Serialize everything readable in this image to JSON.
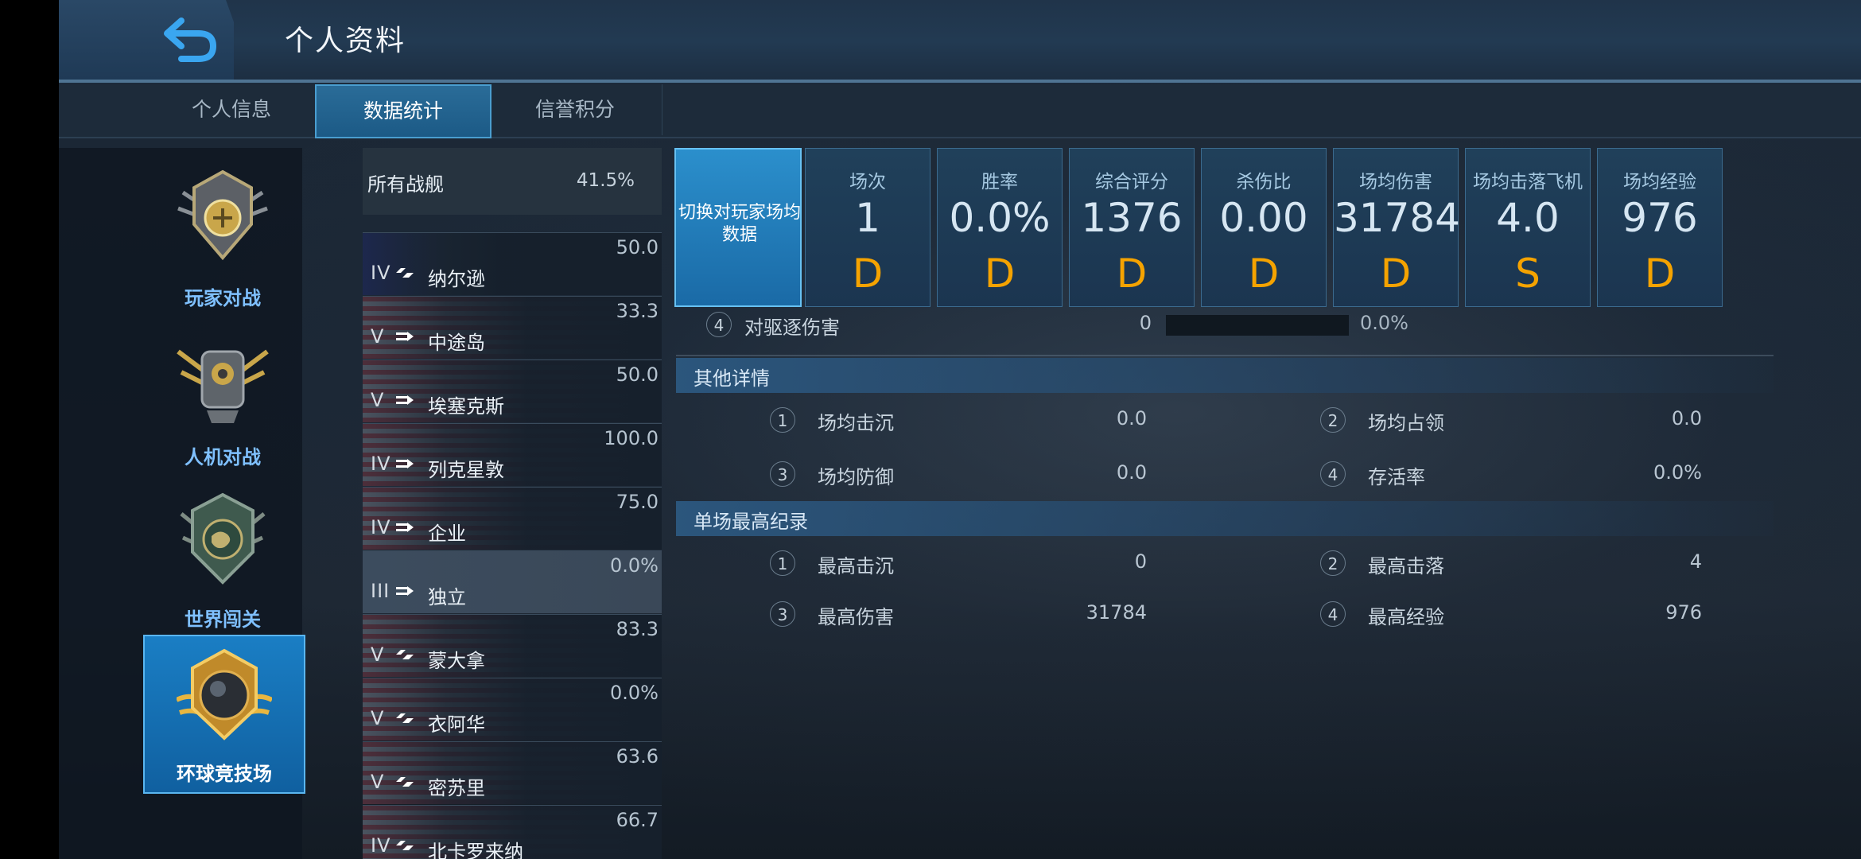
{
  "header": {
    "title": "个人资料"
  },
  "tabs": [
    {
      "label": "个人信息"
    },
    {
      "label": "数据统计"
    },
    {
      "label": "信誉积分"
    }
  ],
  "modes": [
    {
      "label": "玩家对战"
    },
    {
      "label": "人机对战"
    },
    {
      "label": "世界闯关"
    },
    {
      "label": "环球竞技场"
    }
  ],
  "ship_list": {
    "all": {
      "name": "所有战舰",
      "winrate": "41.5%"
    },
    "ships": [
      {
        "tier": "IV",
        "name": "纳尔逊",
        "winrate": "50.0"
      },
      {
        "tier": "V",
        "name": "中途岛",
        "winrate": "33.3"
      },
      {
        "tier": "V",
        "name": "埃塞克斯",
        "winrate": "50.0"
      },
      {
        "tier": "IV",
        "name": "列克星敦",
        "winrate": "100.0"
      },
      {
        "tier": "IV",
        "name": "企业",
        "winrate": "75.0"
      },
      {
        "tier": "III",
        "name": "独立",
        "winrate": "0.0%"
      },
      {
        "tier": "V",
        "name": "蒙大拿",
        "winrate": "83.3"
      },
      {
        "tier": "V",
        "name": "衣阿华",
        "winrate": "0.0%"
      },
      {
        "tier": "V",
        "name": "密苏里",
        "winrate": "63.6"
      },
      {
        "tier": "IV",
        "name": "北卡罗来纳",
        "winrate": "66.7"
      }
    ]
  },
  "stats": {
    "switch_label": "切换对玩家场均数据",
    "cards": [
      {
        "label": "场次",
        "value": "1",
        "grade": "D"
      },
      {
        "label": "胜率",
        "value": "0.0%",
        "grade": "D"
      },
      {
        "label": "综合评分",
        "value": "1376",
        "grade": "D"
      },
      {
        "label": "杀伤比",
        "value": "0.00",
        "grade": "D"
      },
      {
        "label": "场均伤害",
        "value": "31784",
        "grade": "D"
      },
      {
        "label": "场均击落飞机",
        "value": "4.0",
        "grade": "S"
      },
      {
        "label": "场均经验",
        "value": "976",
        "grade": "D"
      }
    ]
  },
  "details": {
    "destroyer_damage": {
      "num": "4",
      "label": "对驱逐伤害",
      "value": "0",
      "percent": "0.0%",
      "fill": 0
    },
    "other": {
      "title": "其他详情",
      "items": [
        {
          "num": "1",
          "label": "场均击沉",
          "value": "0.0"
        },
        {
          "num": "2",
          "label": "场均占领",
          "value": "0.0"
        },
        {
          "num": "3",
          "label": "场均防御",
          "value": "0.0"
        },
        {
          "num": "4",
          "label": "存活率",
          "value": "0.0%"
        }
      ]
    },
    "records": {
      "title": "单场最高纪录",
      "items": [
        {
          "num": "1",
          "label": "最高击沉",
          "value": "0"
        },
        {
          "num": "2",
          "label": "最高击落",
          "value": "4"
        },
        {
          "num": "3",
          "label": "最高伤害",
          "value": "31784"
        },
        {
          "num": "4",
          "label": "最高经验",
          "value": "976"
        }
      ]
    }
  },
  "colors": {
    "grade": "#f5a300",
    "active_tab": "#1c5a86",
    "accent": "#4a9ed0"
  }
}
